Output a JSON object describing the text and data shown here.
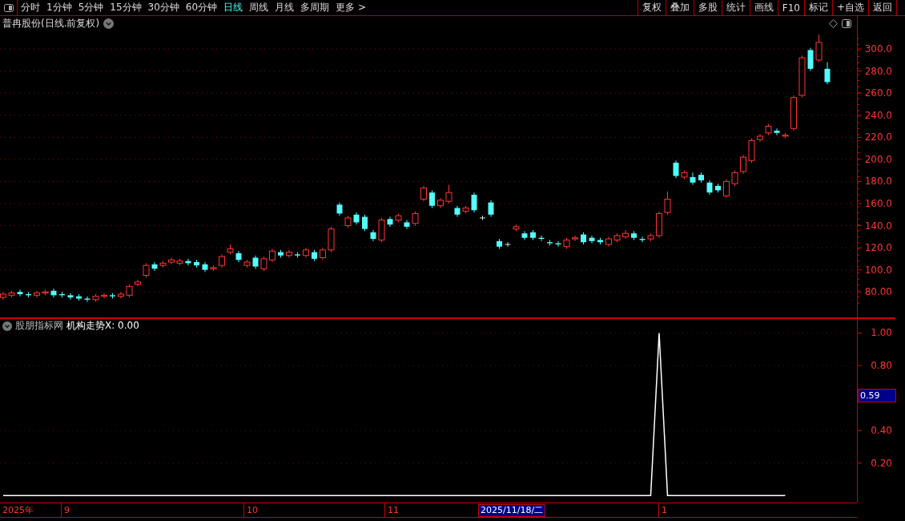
{
  "toolbar": {
    "tabs": [
      {
        "label": "分时",
        "selected": false
      },
      {
        "label": "1分钟",
        "selected": false
      },
      {
        "label": "5分钟",
        "selected": false
      },
      {
        "label": "15分钟",
        "selected": false
      },
      {
        "label": "30分钟",
        "selected": false
      },
      {
        "label": "60分钟",
        "selected": false
      },
      {
        "label": "日线",
        "selected": true
      },
      {
        "label": "周线",
        "selected": false
      },
      {
        "label": "月线",
        "selected": false
      },
      {
        "label": "多周期",
        "selected": false
      },
      {
        "label": "更多 >",
        "selected": false
      }
    ],
    "buttons": [
      "复权",
      "叠加",
      "多股",
      "统计",
      "画线",
      "F10",
      "标记",
      "+自选",
      "返回"
    ]
  },
  "price_panel": {
    "title": "普冉股份(日线.前复权)",
    "chart_data": {
      "type": "candlestick",
      "grid": true,
      "ylim": [
        56.2,
        329.8
      ],
      "yticks": [
        {
          "value": 300,
          "label": "300.0"
        },
        {
          "value": 280,
          "label": "280.0"
        },
        {
          "value": 260,
          "label": "260.0"
        },
        {
          "value": 240,
          "label": "240.0"
        },
        {
          "value": 220,
          "label": "220.0"
        },
        {
          "value": 200,
          "label": "200.0"
        },
        {
          "value": 180,
          "label": "180.0"
        },
        {
          "value": 160,
          "label": "160.0"
        },
        {
          "value": 140,
          "label": "140.0"
        },
        {
          "value": 120,
          "label": "120.0"
        },
        {
          "value": 100,
          "label": "100.0"
        },
        {
          "value": 80,
          "label": "80.00"
        }
      ],
      "categories": [
        null,
        null,
        null,
        null,
        null,
        null,
        null,
        null,
        null,
        null,
        null,
        null,
        null,
        null,
        null,
        null,
        null,
        null,
        null,
        null,
        null,
        null,
        null,
        null,
        null,
        null,
        null,
        null,
        null,
        null,
        null,
        null,
        null,
        null,
        null,
        null,
        null,
        null,
        null,
        null,
        null,
        null,
        null,
        null,
        null,
        null,
        null,
        null,
        null,
        null,
        null,
        null,
        null,
        null,
        null,
        null,
        null,
        null,
        null,
        null,
        null,
        null,
        null,
        null,
        null,
        null,
        null,
        null,
        null,
        null,
        null,
        null,
        null,
        null,
        null,
        null,
        null,
        null,
        null,
        null,
        null,
        null,
        null,
        null,
        null,
        null,
        null,
        null,
        null,
        null,
        null,
        null,
        null,
        null,
        null,
        null,
        null,
        null,
        null
      ],
      "ohlc": [
        [
          75,
          80,
          73,
          78
        ],
        [
          77,
          81,
          75,
          79
        ],
        [
          80,
          82,
          76,
          78
        ],
        [
          78,
          80,
          75,
          77
        ],
        [
          77,
          81,
          75,
          79
        ],
        [
          79,
          82,
          77,
          80
        ],
        [
          81,
          83,
          75,
          77
        ],
        [
          78,
          80,
          75,
          77
        ],
        [
          77,
          79,
          73,
          75
        ],
        [
          76,
          78,
          72,
          74
        ],
        [
          74,
          76,
          71,
          73
        ],
        [
          73,
          78,
          71,
          76
        ],
        [
          76,
          79,
          74,
          77
        ],
        [
          77,
          79,
          74,
          76
        ],
        [
          76,
          80,
          74,
          78
        ],
        [
          77,
          87,
          75,
          85
        ],
        [
          87,
          91,
          85,
          89
        ],
        [
          95,
          106,
          93,
          104
        ],
        [
          105,
          107,
          99,
          101
        ],
        [
          104,
          108,
          102,
          106
        ],
        [
          107,
          111,
          105,
          109
        ],
        [
          106,
          110,
          104,
          108
        ],
        [
          108,
          110,
          104,
          106
        ],
        [
          107,
          109,
          102,
          104
        ],
        [
          105,
          107,
          98,
          100
        ],
        [
          101,
          104,
          99,
          102
        ],
        [
          104,
          114,
          102,
          112
        ],
        [
          116,
          123,
          114,
          119
        ],
        [
          115,
          117,
          107,
          109
        ],
        [
          104,
          109,
          102,
          107
        ],
        [
          111,
          113,
          101,
          103
        ],
        [
          101,
          112,
          99,
          110
        ],
        [
          109,
          119,
          107,
          117
        ],
        [
          116,
          118,
          111,
          113
        ],
        [
          113,
          118,
          111,
          116
        ],
        [
          114,
          116,
          111,
          113
        ],
        [
          113,
          120,
          111,
          118
        ],
        [
          116,
          118,
          108,
          110
        ],
        [
          111,
          120,
          109,
          118
        ],
        [
          118,
          139,
          116,
          137
        ],
        [
          159,
          161,
          149,
          151
        ],
        [
          140,
          149,
          138,
          147
        ],
        [
          150,
          152,
          141,
          143
        ],
        [
          148,
          150,
          135,
          137
        ],
        [
          134,
          136,
          126,
          128
        ],
        [
          127,
          147,
          125,
          145
        ],
        [
          146,
          148,
          139,
          141
        ],
        [
          145,
          151,
          143,
          149
        ],
        [
          143,
          145,
          137,
          139
        ],
        [
          142,
          153,
          140,
          151
        ],
        [
          164,
          176,
          162,
          174
        ],
        [
          170,
          172,
          156,
          158
        ],
        [
          158,
          165,
          156,
          163
        ],
        [
          162,
          177,
          160,
          170
        ],
        [
          156,
          158,
          148,
          150
        ],
        [
          153,
          158,
          151,
          156
        ],
        [
          168,
          170,
          152,
          154
        ],
        [
          147,
          149,
          145,
          147
        ],
        [
          161,
          163,
          148,
          150
        ],
        [
          126,
          128,
          119,
          121
        ],
        [
          123,
          125,
          121,
          123
        ],
        [
          137,
          141,
          135,
          139
        ],
        [
          133,
          135,
          127,
          129
        ],
        [
          134,
          136,
          127,
          129
        ],
        [
          129,
          131,
          126,
          128
        ],
        [
          125,
          127,
          122,
          124
        ],
        [
          124,
          126,
          121,
          123
        ],
        [
          121,
          129,
          119,
          127
        ],
        [
          128,
          131,
          126,
          129
        ],
        [
          132,
          134,
          123,
          125
        ],
        [
          129,
          131,
          124,
          126
        ],
        [
          127,
          129,
          123,
          125
        ],
        [
          123,
          130,
          121,
          128
        ],
        [
          127,
          133,
          125,
          131
        ],
        [
          130,
          136,
          128,
          133
        ],
        [
          133,
          135,
          127,
          129
        ],
        [
          128,
          130,
          125,
          127
        ],
        [
          128,
          133,
          126,
          131
        ],
        [
          131,
          153,
          129,
          151
        ],
        [
          152,
          171,
          150,
          164
        ],
        [
          197,
          199,
          183,
          185
        ],
        [
          184,
          190,
          182,
          188
        ],
        [
          184,
          188,
          177,
          179
        ],
        [
          186,
          188,
          179,
          181
        ],
        [
          179,
          181,
          168,
          170
        ],
        [
          176,
          178,
          170,
          172
        ],
        [
          167,
          182,
          165,
          180
        ],
        [
          178,
          190,
          176,
          188
        ],
        [
          189,
          204,
          187,
          202
        ],
        [
          199,
          219,
          197,
          217
        ],
        [
          218,
          223,
          216,
          221
        ],
        [
          224,
          232,
          222,
          230
        ],
        [
          226,
          228,
          222,
          224
        ],
        [
          221,
          224,
          219,
          222
        ],
        [
          228,
          258,
          226,
          256
        ],
        [
          258,
          294,
          256,
          292
        ],
        [
          299,
          301,
          280,
          282
        ],
        [
          290,
          313,
          288,
          306
        ],
        [
          282,
          288,
          268,
          270
        ]
      ]
    }
  },
  "indicator_panel": {
    "source": "股朋指标网",
    "label": "机构走势X: 0.00",
    "chart_data": {
      "type": "line",
      "grid": true,
      "ylim": [
        -0.043,
        1.091
      ],
      "yticks": [
        {
          "value": 1,
          "label": "1.00"
        },
        {
          "value": 0.8,
          "label": "0.80"
        },
        {
          "value": 0.4,
          "label": "0.40"
        },
        {
          "value": 0.2,
          "label": "0.20"
        }
      ],
      "categories": [
        null,
        null,
        null,
        null,
        null,
        null,
        null,
        null,
        null,
        null,
        null,
        null,
        null,
        null,
        null,
        null,
        null,
        null,
        null,
        null,
        null,
        null,
        null,
        null,
        null,
        null,
        null,
        null,
        null,
        null,
        null,
        null,
        null,
        null,
        null,
        null,
        null,
        null,
        null,
        null,
        null,
        null,
        null,
        null,
        null,
        null,
        null,
        null,
        null,
        null,
        null,
        null,
        null,
        null,
        null,
        null,
        null,
        null,
        null,
        null,
        null,
        null,
        null,
        null,
        null,
        null,
        null,
        null,
        null,
        null,
        null,
        null,
        null,
        null,
        null,
        null,
        null,
        null,
        null,
        null,
        null,
        null,
        null,
        null,
        null,
        null,
        null,
        null,
        null,
        null,
        null,
        null,
        null,
        null
      ],
      "series": [
        {
          "color": "#ffffff",
          "values": [
            0,
            0,
            0,
            0,
            0,
            0,
            0,
            0,
            0,
            0,
            0,
            0,
            0,
            0,
            0,
            0,
            0,
            0,
            0,
            0,
            0,
            0,
            0,
            0,
            0,
            0,
            0,
            0,
            0,
            0,
            0,
            0,
            0,
            0,
            0,
            0,
            0,
            0,
            0,
            0,
            0,
            0,
            0,
            0,
            0,
            0,
            0,
            0,
            0,
            0,
            0,
            0,
            0,
            0,
            0,
            0,
            0,
            0,
            0,
            0,
            0,
            0,
            0,
            0,
            0,
            0,
            0,
            0,
            0,
            0,
            0,
            0,
            0,
            0,
            0,
            0,
            0,
            0,
            1,
            0,
            0,
            0,
            0,
            0,
            0,
            0,
            0,
            0,
            0,
            0,
            0,
            0,
            0,
            0
          ]
        }
      ]
    },
    "crosshair_value": "0.59"
  },
  "time_axis": {
    "labels": [
      "2025年",
      "9",
      "10",
      "11",
      "1"
    ],
    "crosshair_date": "2025/11/18/二"
  }
}
